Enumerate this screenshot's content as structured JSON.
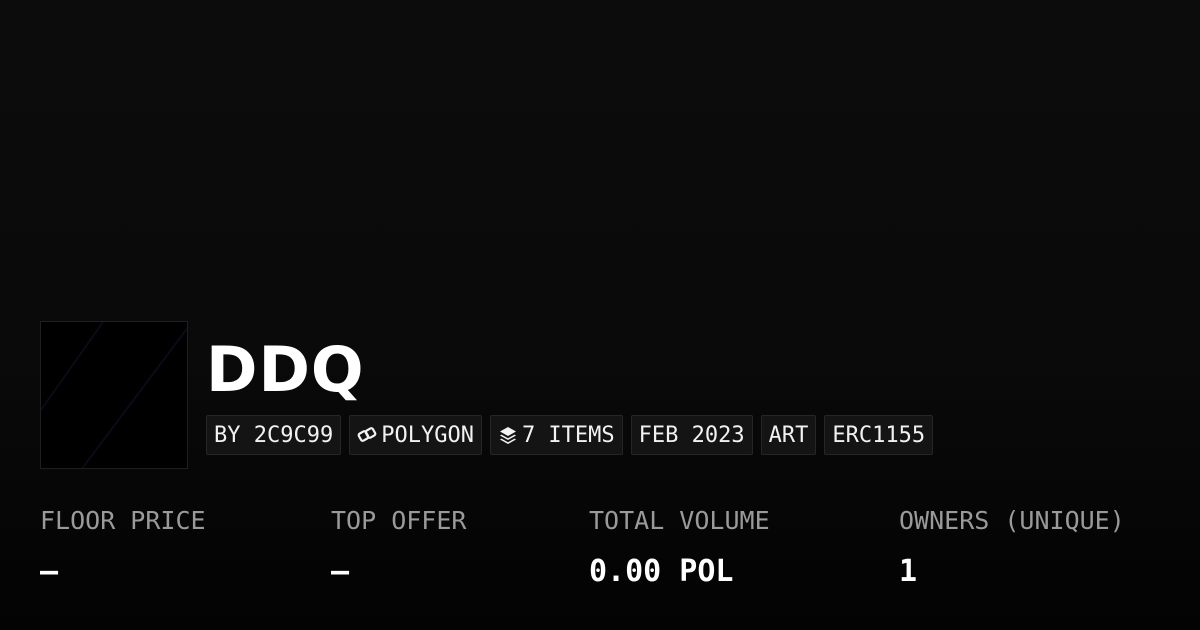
{
  "collection": {
    "name": "DDQ",
    "avatar_icon": "collection-image-placeholder"
  },
  "tags": {
    "creator": "BY 2C9C99",
    "chain": {
      "icon": "polygon-chain-icon",
      "label": "POLYGON"
    },
    "items": {
      "icon": "layers-stack-icon",
      "label": "7 ITEMS"
    },
    "date": "FEB 2023",
    "category": "ART",
    "standard": "ERC1155"
  },
  "stats": [
    {
      "label": "FLOOR PRICE",
      "value": "–"
    },
    {
      "label": "TOP OFFER",
      "value": "–"
    },
    {
      "label": "TOTAL VOLUME",
      "value": "0.00 POL"
    },
    {
      "label": "OWNERS (UNIQUE)",
      "value": "1"
    }
  ],
  "colors": {
    "background": "#0a0a0a",
    "text": "#ffffff",
    "muted": "#9a9a9a",
    "tag_bg": "#141414",
    "tag_border": "#262626"
  }
}
